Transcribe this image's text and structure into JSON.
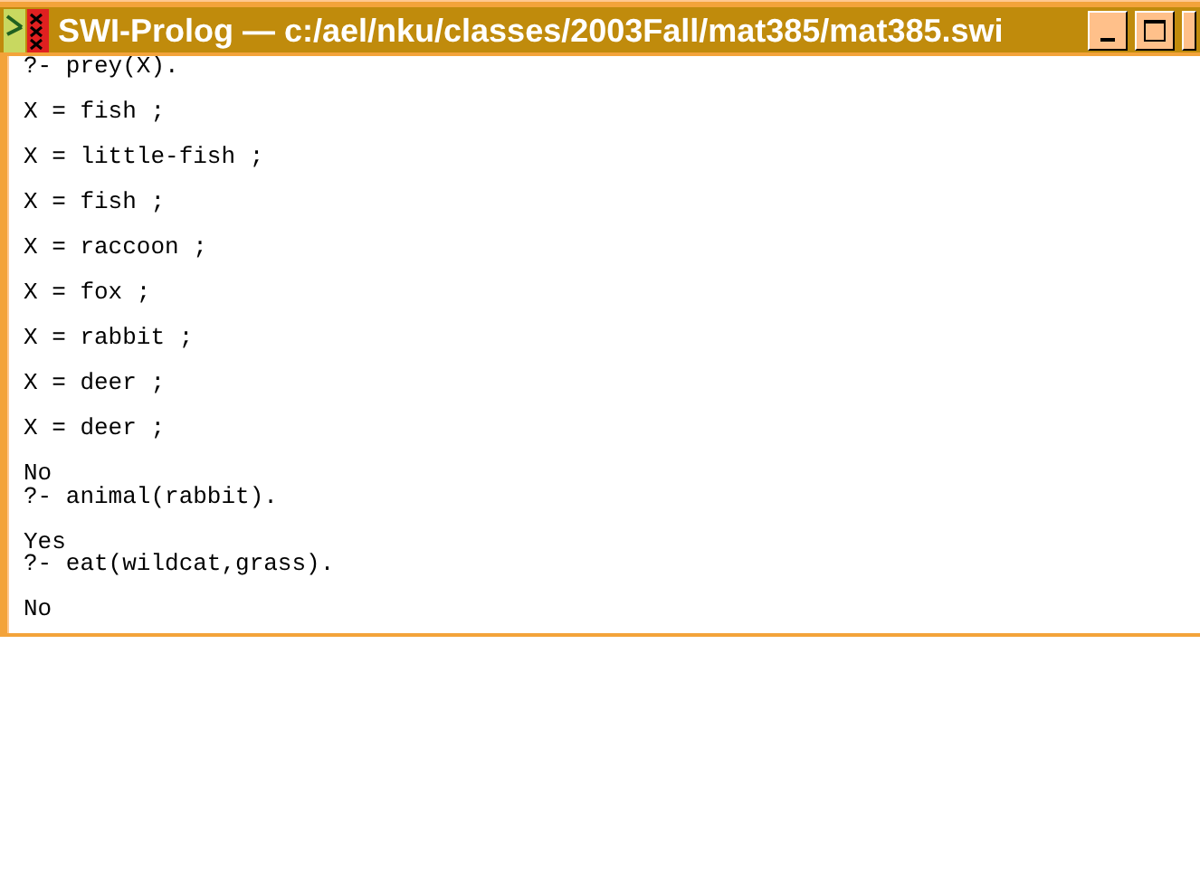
{
  "window": {
    "title": "SWI-Prolog — c:/ael/nku/classes/2003Fall/mat385/mat385.swi"
  },
  "console": [
    {
      "text": "?- prey(X).",
      "blank_before": false
    },
    {
      "text": "X = fish ;",
      "blank_before": true
    },
    {
      "text": "X = little-fish ;",
      "blank_before": true
    },
    {
      "text": "X = fish ;",
      "blank_before": true
    },
    {
      "text": "X = raccoon ;",
      "blank_before": true
    },
    {
      "text": "X = fox ;",
      "blank_before": true
    },
    {
      "text": "X = rabbit ;",
      "blank_before": true
    },
    {
      "text": "X = deer ;",
      "blank_before": true
    },
    {
      "text": "X = deer ;",
      "blank_before": true
    },
    {
      "text": "No",
      "blank_before": true
    },
    {
      "text": "?- animal(rabbit).",
      "blank_before": false
    },
    {
      "text": "Yes",
      "blank_before": true
    },
    {
      "text": "?- eat(wildcat,grass).",
      "blank_before": false
    },
    {
      "text": "No",
      "blank_before": true
    }
  ]
}
